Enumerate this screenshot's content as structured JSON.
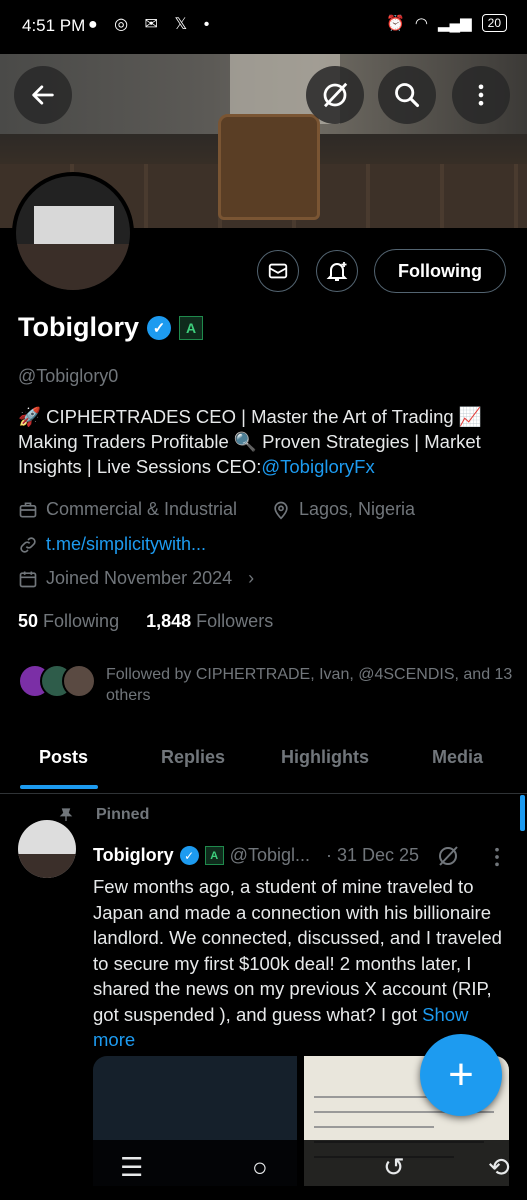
{
  "status_bar": {
    "time": "4:51 PM",
    "battery": "20"
  },
  "profile": {
    "name": "Tobiglory",
    "handle": "@Tobiglory0",
    "bio_text": "🚀 CIPHERTRADES CEO | Master the  Art of Trading 📈 Making Traders Profitable 🔍 Proven Strategies | Market Insights | Live Sessions CEO:",
    "bio_link": "@TobigloryFx",
    "category": "Commercial & Industrial",
    "location": "Lagos, Nigeria",
    "website": "t.me/simplicitywith...",
    "joined": "Joined November 2024",
    "following_count": "50",
    "following_label": "Following",
    "followers_count": "1,848",
    "followers_label": "Followers",
    "followed_by": "Followed by CIPHERTRADE, Ivan, @4SCENDIS, and 13 others",
    "following_button": "Following"
  },
  "tabs": [
    "Posts",
    "Replies",
    "Highlights",
    "Media"
  ],
  "active_tab": "Posts",
  "pinned_post": {
    "pinned_label": "Pinned",
    "author": "Tobiglory",
    "handle": "@Tobigl...",
    "date": "· 31 Dec 25",
    "text": "Few months ago, a student of mine traveled to Japan and made a connection with his billionaire landlord. We connected, discussed, and I traveled to secure my first $100k deal! 2 months later, I shared the news on my previous X account (RIP, got suspended ), and guess what? I got ",
    "show_more": "Show more"
  },
  "colors": {
    "accent": "#1d9bf0",
    "muted": "#71767b",
    "background": "#000000"
  },
  "icons": [
    "back-arrow-icon",
    "grok-icon",
    "search-icon",
    "more-vertical-icon",
    "mail-icon",
    "notification-bell-icon",
    "verified-icon",
    "briefcase-icon",
    "location-pin-icon",
    "link-icon",
    "calendar-icon",
    "pin-icon",
    "compose-plus-icon"
  ]
}
